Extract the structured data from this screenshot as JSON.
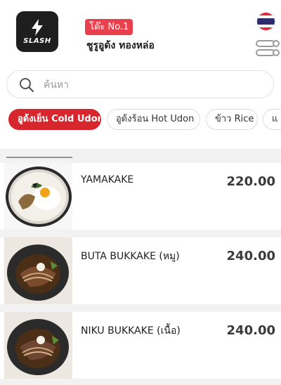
{
  "header": {
    "logo_text": "SLASH",
    "table_label": "โต๊ะ No.1",
    "store_name": "ชูรูอูด้ง ทองหล่อ"
  },
  "search": {
    "placeholder": "ค้นหา"
  },
  "categories": [
    {
      "label": "อูด้งเย็น Cold Udon",
      "active": true
    },
    {
      "label": "อูด้งร้อน Hot Udon",
      "active": false
    },
    {
      "label": "ข้าว Rice",
      "active": false
    },
    {
      "label": "แ",
      "active": false
    }
  ],
  "items": [
    {
      "name": "YAMAKAKE",
      "price": "220.00",
      "image": "yamakake-bowl"
    },
    {
      "name": "BUTA BUKKAKE (หมู)",
      "price": "240.00",
      "image": "buta-bukkake-bowl"
    },
    {
      "name": "NIKU BUKKAKE (เนื้อ)",
      "price": "240.00",
      "image": "niku-bukkake-bowl"
    }
  ],
  "colors": {
    "accent": "#d8262e",
    "badge": "#e8414d",
    "logo_bg": "#1e1e1e",
    "page_bg": "#f2f2f2"
  },
  "icons": {
    "logo": "lightning-bolt-icon",
    "search": "search-icon",
    "language": "thai-flag-icon",
    "view_toggle": "toggle-icon"
  }
}
